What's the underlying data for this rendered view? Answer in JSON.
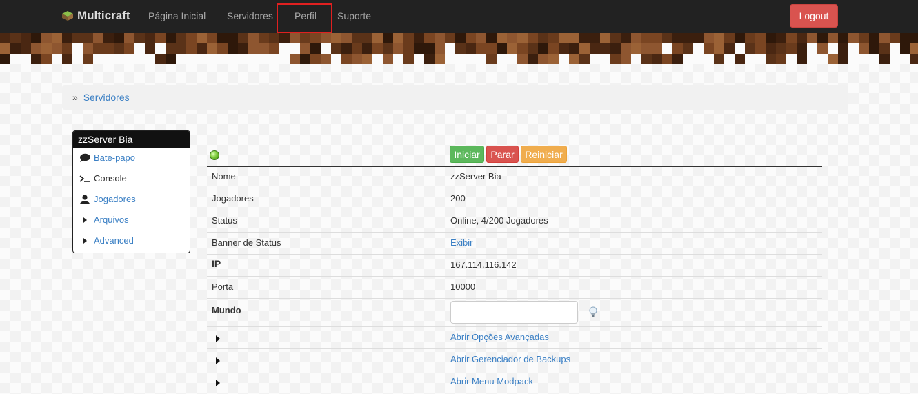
{
  "navbar": {
    "brand": "Multicraft",
    "links": [
      "Página Inicial",
      "Servidores",
      "Perfil",
      "Suporte"
    ],
    "logout": "Logout"
  },
  "breadcrumb": {
    "separator": "»",
    "link": "Servidores"
  },
  "sidebar": {
    "title": "zzServer Bia",
    "items": [
      {
        "label": "Bate-papo",
        "icon": "chat-bubble-icon"
      },
      {
        "label": "Console",
        "icon": "console-prompt-icon"
      },
      {
        "label": "Jogadores",
        "icon": "user-icon"
      },
      {
        "label": "Arquivos",
        "icon": "caret-right-icon"
      },
      {
        "label": "Advanced",
        "icon": "caret-right-icon"
      }
    ]
  },
  "controls": {
    "status_icon": "online-status-dot",
    "start": "Iniciar",
    "stop": "Parar",
    "restart": "Reiniciar"
  },
  "server_info": {
    "name_label": "Nome",
    "name_value": "zzServer Bia",
    "players_label": "Jogadores",
    "players_value": "200",
    "status_label": "Status",
    "status_value": "Online, 4/200 Jogadores",
    "banner_label": "Banner de Status",
    "banner_value": "Exibir",
    "ip_label": "IP",
    "ip_value": "167.114.116.142",
    "port_label": "Porta",
    "port_value": "10000",
    "world_label": "Mundo",
    "world_value": ""
  },
  "expanders": [
    {
      "label": "Abrir Opções Avançadas"
    },
    {
      "label": "Abrir Gerenciador de Backups"
    },
    {
      "label": "Abrir Menu Modpack"
    }
  ],
  "colors": {
    "navbar_bg": "#222222",
    "link": "#3a7fc4",
    "start_btn": "#5cb85c",
    "stop_btn": "#d9534f",
    "restart_btn": "#f0ad4e",
    "logout_btn": "#d9534f",
    "highlight_box": "#e02020"
  }
}
